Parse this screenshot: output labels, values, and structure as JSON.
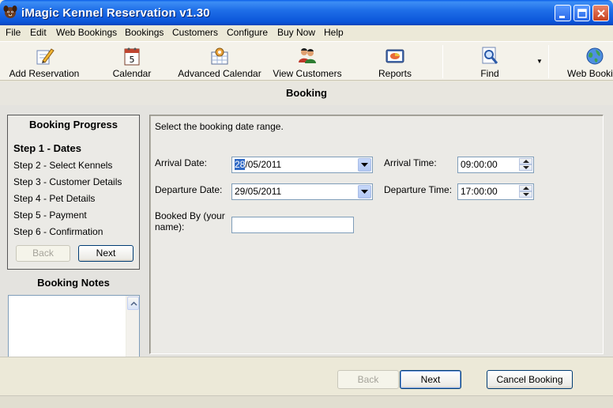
{
  "window": {
    "title": "iMagic Kennel Reservation v1.30"
  },
  "menu": [
    "File",
    "Edit",
    "Web Bookings",
    "Bookings",
    "Customers",
    "Configure",
    "Buy Now",
    "Help"
  ],
  "toolbar": {
    "add_reservation": "Add Reservation",
    "calendar": "Calendar",
    "advanced_calendar": "Advanced Calendar",
    "view_customers": "View Customers",
    "reports": "Reports",
    "find": "Find",
    "web_bookings": "Web Booki"
  },
  "section_title": "Booking",
  "progress": {
    "title": "Booking Progress",
    "steps": [
      "Step 1 - Dates",
      "Step 2 - Select Kennels",
      "Step 3 - Customer Details",
      "Step 4 - Pet Details",
      "Step 5 - Payment",
      "Step 6 - Confirmation"
    ],
    "back_label": "Back",
    "next_label": "Next"
  },
  "notes": {
    "title": "Booking Notes"
  },
  "form": {
    "instruction": "Select the booking date range.",
    "arrival_date_label": "Arrival Date:",
    "arrival_date_day": "28",
    "arrival_date_rest": "/05/2011",
    "departure_date_label": "Departure Date:",
    "departure_date_value": "29/05/2011",
    "arrival_time_label": "Arrival Time:",
    "arrival_time_value": "09:00:00",
    "departure_time_label": "Departure Time:",
    "departure_time_value": "17:00:00",
    "booked_by_label_line1": "Booked By (your",
    "booked_by_label_line2": "name):",
    "booked_by_value": ""
  },
  "footer": {
    "back_label": "Back",
    "next_label": "Next",
    "cancel_label": "Cancel Booking"
  }
}
